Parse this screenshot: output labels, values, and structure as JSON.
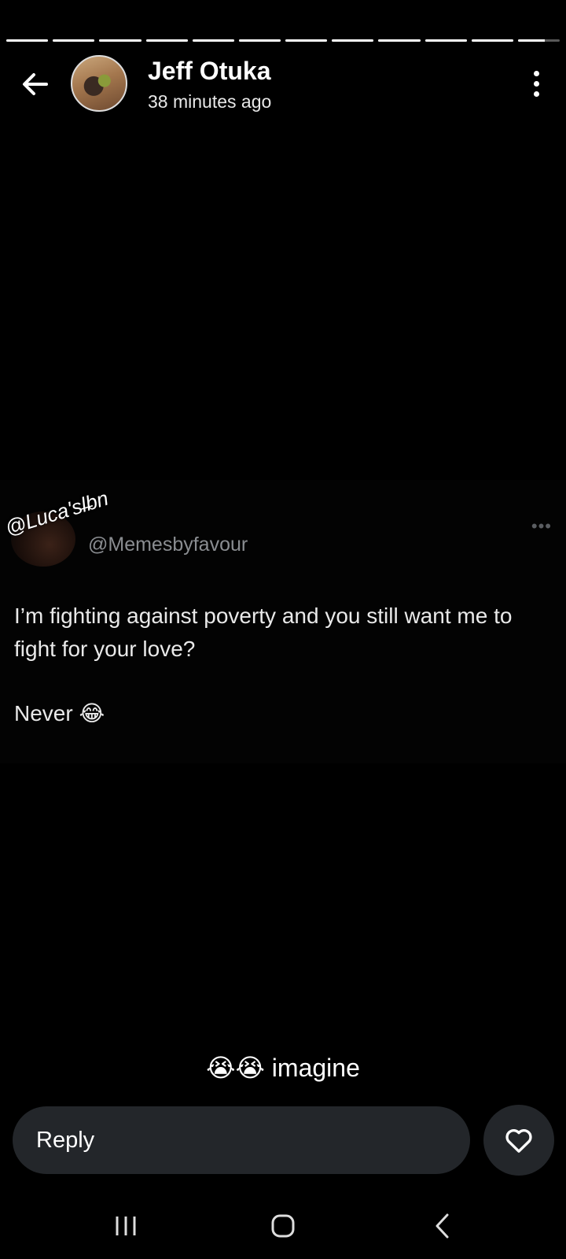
{
  "story": {
    "segments_total": 12,
    "segments_viewed": 11,
    "current_segment_progress": 0.65
  },
  "header": {
    "user_name": "Jeff Otuka",
    "posted_time": "38 minutes ago",
    "back_icon": "arrow-left-icon",
    "more_icon": "more-vertical-icon"
  },
  "tweet": {
    "watermark": "@Luca'sl̶bn",
    "handle": "@Memesbyfavour",
    "dots": "•••",
    "line1": "I’m fighting against poverty and you still want me to fight for your love?",
    "line2": "Never 😂"
  },
  "caption": "😭😭 imagine",
  "reply": {
    "placeholder": "Reply",
    "like_icon": "heart-icon"
  },
  "navbar": {
    "recents_icon": "recents-icon",
    "home_icon": "home-icon",
    "back_icon": "nav-back-icon"
  },
  "colors": {
    "background": "#000000",
    "reply_bg": "#23262a",
    "handle_gray": "#8a8d91"
  }
}
